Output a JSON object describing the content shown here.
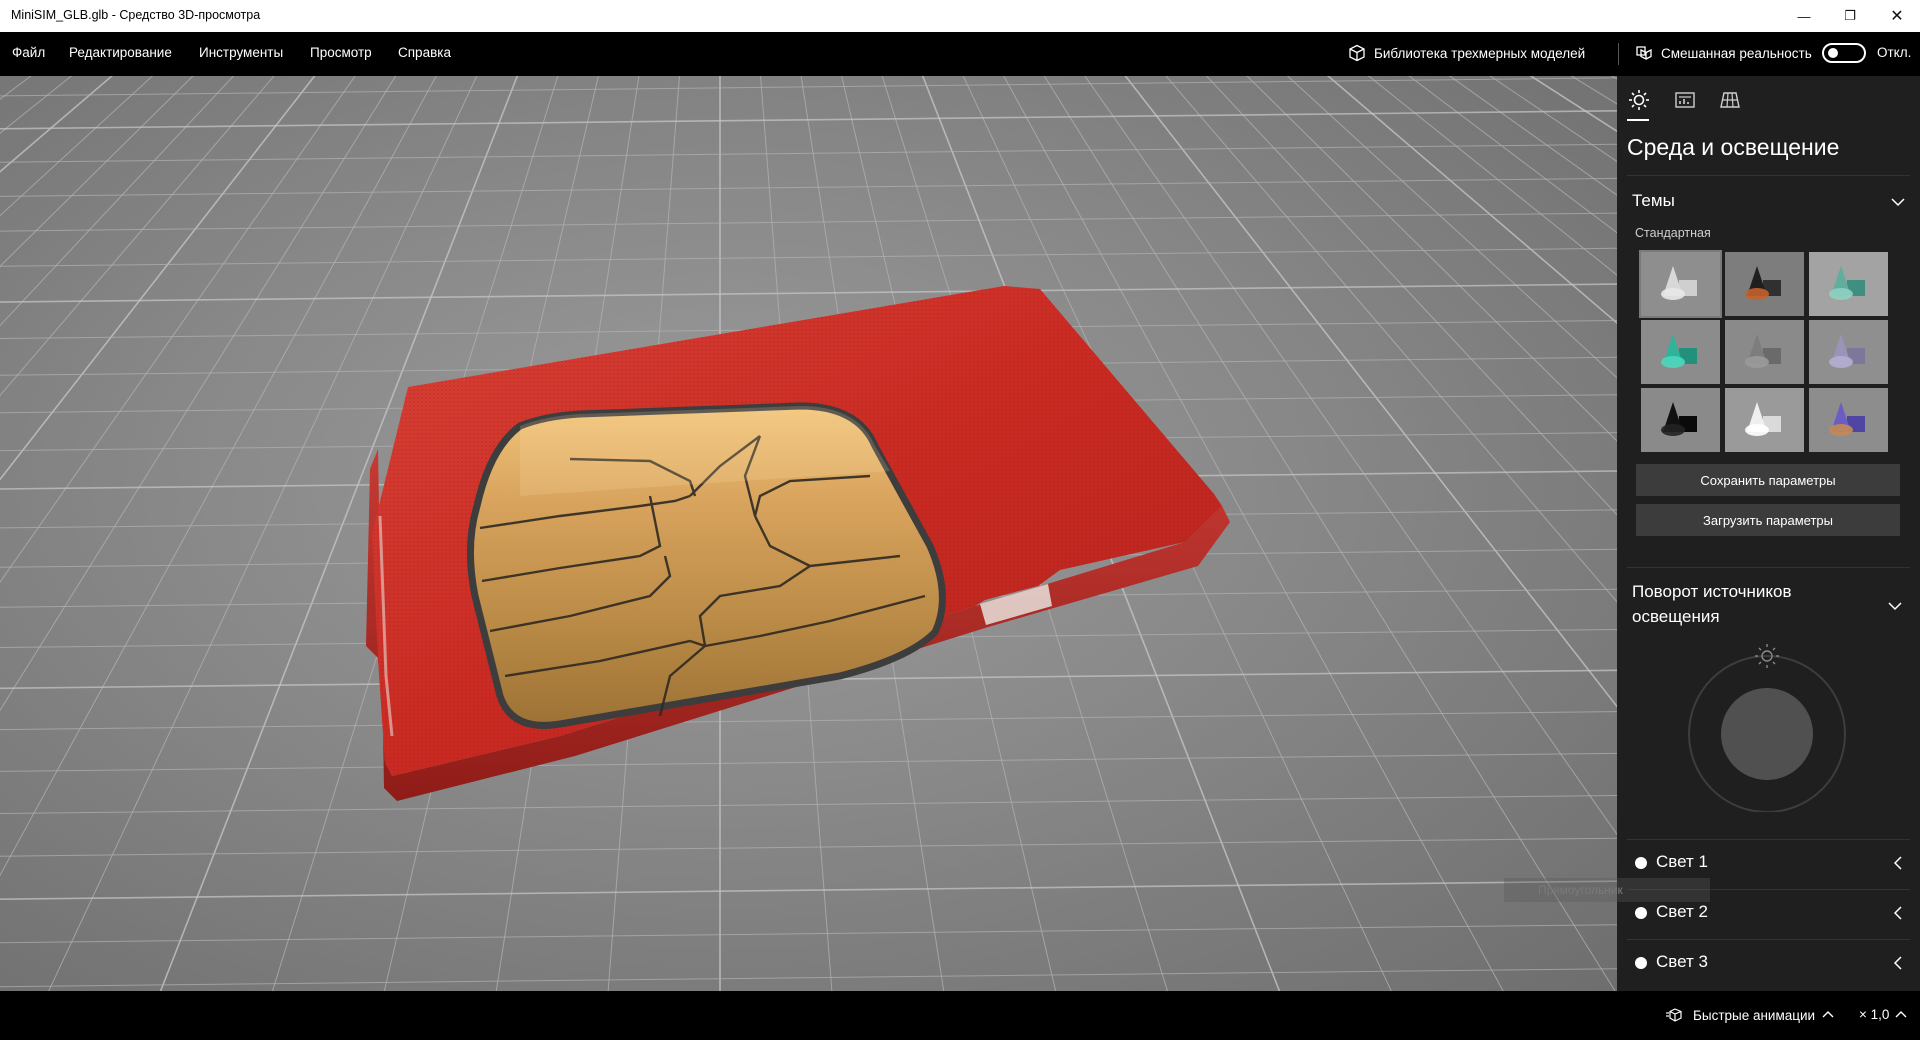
{
  "window": {
    "title": "MiniSIM_GLB.glb - Средство 3D-просмотра",
    "minimize": "—",
    "maximize": "❐",
    "close": "✕"
  },
  "menu": {
    "items": [
      "Файл",
      "Редактирование",
      "Инструменты",
      "Просмотр",
      "Справка"
    ],
    "library_label": "Библиотека трехмерных моделей",
    "mixed_reality_label": "Смешанная реальность",
    "mixed_reality_state": "Откл."
  },
  "panel": {
    "tabs": [
      "sun-icon",
      "stats-icon",
      "grid-icon"
    ],
    "active_tab": 0,
    "title": "Среда и освещение",
    "themes_header": "Темы",
    "themes_subhead": "Стандартная",
    "themes": [
      {
        "name": "white",
        "colors": [
          "#d8d8d8",
          "#e8e8e8",
          "#cfcfcf"
        ],
        "bg": "#8e8e8e"
      },
      {
        "name": "orange-dark",
        "colors": [
          "#1f1f1f",
          "#c4622d",
          "#303030"
        ],
        "bg": "#7d7d7d"
      },
      {
        "name": "teal-grey",
        "colors": [
          "#5fae9e",
          "#8fd0c2",
          "#3f8f80"
        ],
        "bg": "#a3a3a3"
      },
      {
        "name": "teal-bright",
        "colors": [
          "#2fb39a",
          "#4fd6bd",
          "#23907c"
        ],
        "bg": "#8c8c8c"
      },
      {
        "name": "grey",
        "colors": [
          "#7d7d7d",
          "#9a9a9a",
          "#6a6a6a"
        ],
        "bg": "#8a8a8a"
      },
      {
        "name": "lavender",
        "colors": [
          "#9a94b8",
          "#b4aed0",
          "#7d7799"
        ],
        "bg": "#8f8f8f"
      },
      {
        "name": "black",
        "colors": [
          "#111111",
          "#222222",
          "#0a0a0a"
        ],
        "bg": "#8a8a8a"
      },
      {
        "name": "white-bright",
        "colors": [
          "#efefef",
          "#ffffff",
          "#dadada"
        ],
        "bg": "#9a9a9a"
      },
      {
        "name": "purple-orange",
        "colors": [
          "#6a5ec4",
          "#c48a55",
          "#4f45a3"
        ],
        "bg": "#8d8d8d"
      }
    ],
    "selected_theme": 0,
    "save_button": "Сохранить параметры",
    "load_button": "Загрузить параметры",
    "rotation_header": "Поворот источников освещения",
    "lights": [
      "Свет 1",
      "Свет 2",
      "Свет 3"
    ],
    "tooltip": "Прямоугольник"
  },
  "statusbar": {
    "fast_animations": "Быстрые анимации",
    "speed": "× 1,0"
  }
}
